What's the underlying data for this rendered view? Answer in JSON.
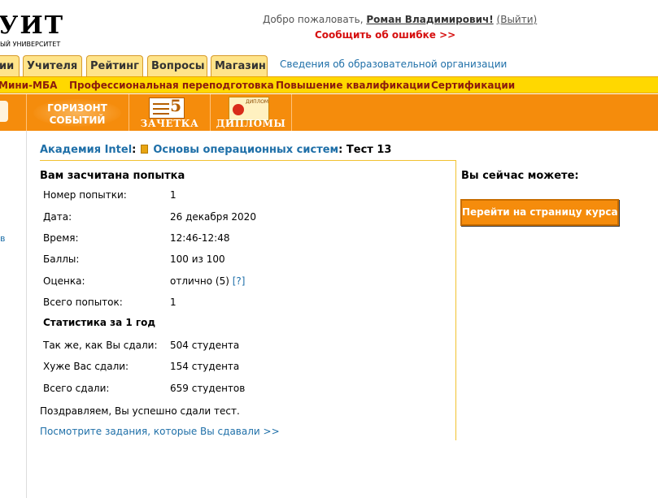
{
  "logo": {
    "big": "УИТ",
    "sub": "ЫЙ УНИВЕРСИТЕТ"
  },
  "header": {
    "welcome_prefix": "Добро пожаловать,",
    "user_name": "Роман Владимирович!",
    "exit_label": "(Выйти)",
    "report_label": "Сообщить об ошибке >>"
  },
  "tabs": [
    {
      "label": "ии"
    },
    {
      "label": "Учителя"
    },
    {
      "label": "Рейтинг"
    },
    {
      "label": "Вопросы"
    },
    {
      "label": "Магазин"
    }
  ],
  "tab_link": "Сведения об образовательной организации",
  "yellow_menu": [
    {
      "label": "Мини-МБА"
    },
    {
      "label": "Профессиональная переподготовка"
    },
    {
      "label": "Повышение квалификации"
    },
    {
      "label": "Сертификации"
    }
  ],
  "orange_menu": {
    "horizon_line1": "ГОРИЗОНТ",
    "horizon_line2": "СОБЫТИЙ",
    "zachetka": "ЗАЧЕТКА",
    "zachetka_icon_text": "5",
    "diplomy": "ДИПЛОМЫ",
    "diplom_icon_text": "ДИПЛОМ"
  },
  "left_stub": "в",
  "breadcrumb": {
    "academy": "Академия Intel",
    "course": "Основы операционных систем",
    "test": ": Тест 13",
    "sep": ":"
  },
  "result": {
    "heading": "Вам засчитана попытка",
    "rows": [
      {
        "label": "Номер попытки:",
        "value": "1"
      },
      {
        "label": "Дата:",
        "value": "26 декабря 2020"
      },
      {
        "label": "Время:",
        "value": "12:46-12:48"
      },
      {
        "label": "Баллы:",
        "value": "100 из 100"
      },
      {
        "label": "Оценка:",
        "value": "отлично (5)",
        "help": "[?]"
      },
      {
        "label": "Всего попыток:",
        "value": "1"
      }
    ],
    "stats_heading": "Статистика за 1 год",
    "stats": [
      {
        "label": "Так же, как Вы сдали:",
        "value": "504 студента"
      },
      {
        "label": "Хуже Вас сдали:",
        "value": "154 студента"
      },
      {
        "label": "Всего сдали:",
        "value": "659 студентов"
      }
    ],
    "congrats": "Поздравляем, Вы успешно сдали тест.",
    "view_link": "Посмотрите задания, которые Вы сдавали >>"
  },
  "sidebar_right": {
    "heading": "Вы сейчас можете:",
    "button": "Перейти на страницу курса"
  },
  "colors": {
    "accent_orange": "#f58c0c",
    "menu_yellow": "#ffd800",
    "tab_yellow": "#ffe48a",
    "link_blue": "#1e6fa8",
    "alert_red": "#d60f0f"
  }
}
